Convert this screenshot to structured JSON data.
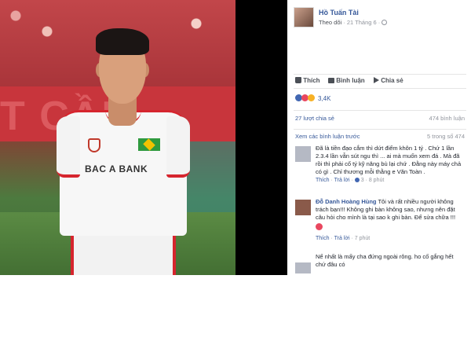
{
  "photo": {
    "banner_text": "T CẦN",
    "sponsor": "BAC A BANK"
  },
  "post": {
    "author": "Hồ Tuấn Tài",
    "follow": "Theo dõi",
    "date": "21 Tháng 6",
    "actions": {
      "like": "Thích",
      "comment": "Bình luận",
      "share": "Chia sẻ"
    },
    "reaction_count": "3,4K",
    "shares": "27 lượt chia sẻ",
    "comments_count": "474 bình luận",
    "view_previous": "Xem các bình luận trước",
    "pager": "5 trong số 474"
  },
  "comments": [
    {
      "author": "",
      "text": "Đã là tiền đạo cắm thì        dứt điểm khôn 1 tý . Chứ 1 lần 2.3.4 lần vẫn sút ngu thì ... ai mà muốn xem        đá . Mà đã        rồi thì phải cố tý kỹ năng bù lại chứ . Đằng này máy chả có gì . Chỉ thương mỗi thằng e Văn Toàn .",
      "like": "Thích",
      "reply": "Trả lời",
      "likes": "3",
      "time": "8 phút"
    },
    {
      "author": "Đỗ Danh Hoàng Hùng",
      "text": "Tôi và rất nhiều người không trách bạn!!! Không ghi bàn không sao, nhưng nên đặt câu hỏi cho mình là tại sao k ghi bàn. Để sửa chữa !!!",
      "like": "Thích",
      "reply": "Trả lời",
      "time": "7 phút"
    },
    {
      "author": "",
      "text": "Nể nhất là mấy cha đứng ngoài rông.        ho cố gắng hết        chứ đâu có"
    }
  ]
}
